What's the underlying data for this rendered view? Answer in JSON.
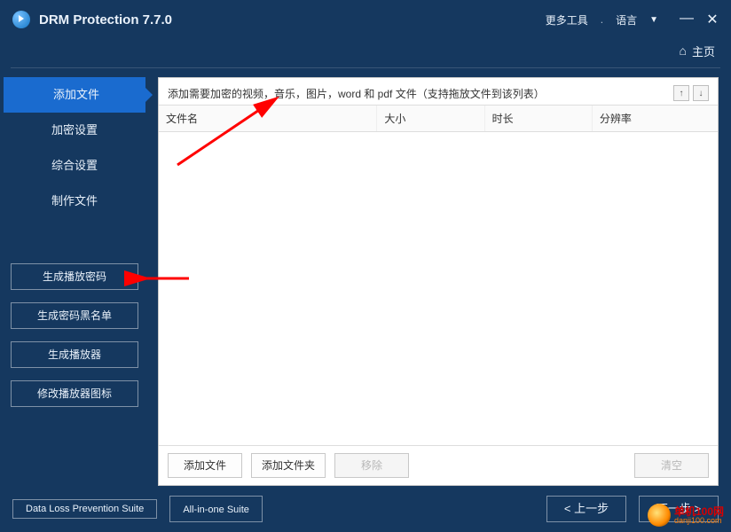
{
  "titlebar": {
    "title": "DRM Protection 7.7.0",
    "more_tools": "更多工具",
    "language": "语言",
    "minimize": "—",
    "close": "✕"
  },
  "homerow": {
    "icon": "⌂",
    "label": "主页"
  },
  "sidebar": {
    "nav": [
      {
        "label": "添加文件",
        "selected": true
      },
      {
        "label": "加密设置",
        "selected": false
      },
      {
        "label": "综合设置",
        "selected": false
      },
      {
        "label": "制作文件",
        "selected": false
      }
    ],
    "buttons": [
      "生成播放密码",
      "生成密码黑名单",
      "生成播放器",
      "修改播放器图标"
    ]
  },
  "panel": {
    "instruction": "添加需要加密的视频，音乐，图片，word 和 pdf 文件（支持拖放文件到该列表）",
    "arrow_up": "↑",
    "arrow_down": "↓",
    "columns": [
      "文件名",
      "大小",
      "时长",
      "分辨率"
    ],
    "footer": {
      "add_file": "添加文件",
      "add_folder": "添加文件夹",
      "remove": "移除",
      "clear": "清空"
    }
  },
  "bottom": {
    "suite1": "Data Loss Prevention Suite",
    "suite2": "All-in-one Suite",
    "prev": "< 上一步",
    "next": "下一步 >"
  },
  "watermark": {
    "line1": "单机100网",
    "line2": "danji100.com"
  }
}
